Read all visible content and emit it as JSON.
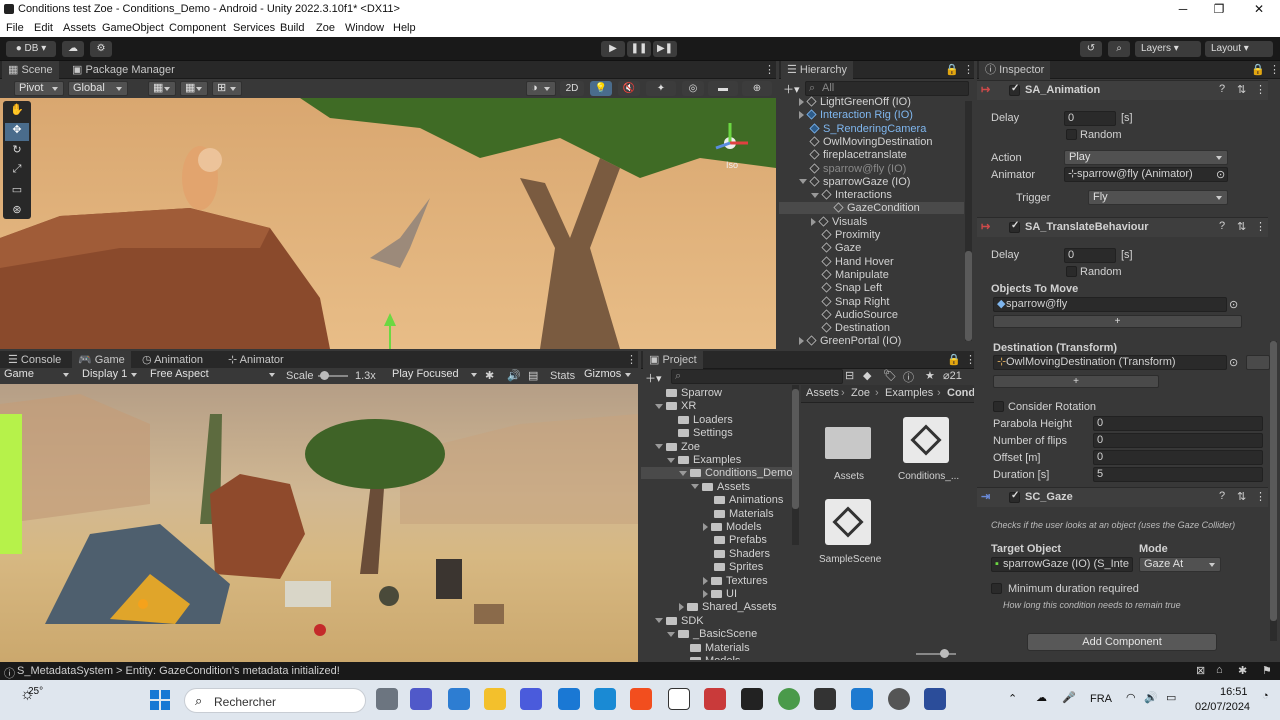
{
  "window": {
    "title": "Conditions test Zoe - Conditions_Demo - Android - Unity 2022.3.10f1* <DX11>",
    "minimize": "─",
    "maximize": "❐",
    "close": "✕"
  },
  "menu": [
    "File",
    "Edit",
    "Assets",
    "GameObject",
    "Component",
    "Services",
    "Build",
    "Zoe",
    "Window",
    "Help"
  ],
  "toolbar": {
    "account": "DB",
    "layers": "Layers",
    "layout": "Layout"
  },
  "scene_panel": {
    "tabs": [
      "Scene",
      "Package Manager"
    ],
    "pivot": "Pivot",
    "global": "Global",
    "mode_2d": "2D",
    "overlay_label": "Iso"
  },
  "hierarchy": {
    "tab": "Hierarchy",
    "search_placeholder": "All",
    "items": [
      {
        "label": "LightGreenOff (IO)",
        "style": "normal",
        "indent": 1,
        "arrow": "right"
      },
      {
        "label": "Interaction Rig (IO)",
        "style": "blue",
        "indent": 1,
        "arrow": "right"
      },
      {
        "label": "S_RenderingCamera",
        "style": "blue",
        "indent": 1,
        "arrow": "none"
      },
      {
        "label": "OwlMovingDestination",
        "style": "normal",
        "indent": 1,
        "arrow": "none"
      },
      {
        "label": "fireplacetranslate",
        "style": "normal",
        "indent": 1,
        "arrow": "none"
      },
      {
        "label": "sparrow@fly (IO)",
        "style": "gray",
        "indent": 1,
        "arrow": "none"
      },
      {
        "label": "sparrowGaze (IO)",
        "style": "normal",
        "indent": 1,
        "arrow": "down"
      },
      {
        "label": "Interactions",
        "style": "normal",
        "indent": 2,
        "arrow": "down"
      },
      {
        "label": "GazeCondition",
        "style": "selected",
        "indent": 3,
        "arrow": "none"
      },
      {
        "label": "Visuals",
        "style": "normal",
        "indent": 2,
        "arrow": "right"
      },
      {
        "label": "Proximity",
        "style": "normal",
        "indent": 2,
        "arrow": "none"
      },
      {
        "label": "Gaze",
        "style": "normal",
        "indent": 2,
        "arrow": "none"
      },
      {
        "label": "Hand Hover",
        "style": "normal",
        "indent": 2,
        "arrow": "none"
      },
      {
        "label": "Manipulate",
        "style": "normal",
        "indent": 2,
        "arrow": "none"
      },
      {
        "label": "Snap Left",
        "style": "normal",
        "indent": 2,
        "arrow": "none"
      },
      {
        "label": "Snap Right",
        "style": "normal",
        "indent": 2,
        "arrow": "none"
      },
      {
        "label": "AudioSource",
        "style": "normal",
        "indent": 2,
        "arrow": "none"
      },
      {
        "label": "Destination",
        "style": "normal",
        "indent": 2,
        "arrow": "none"
      },
      {
        "label": "GreenPortal (IO)",
        "style": "normal",
        "indent": 1,
        "arrow": "right"
      }
    ]
  },
  "game_panel": {
    "tabs": [
      "Console",
      "Game",
      "Animation",
      "Animator"
    ],
    "display_mode": "Game",
    "display": "Display 1",
    "aspect": "Free Aspect",
    "scale_label": "Scale",
    "scale_value": "1.3x",
    "play_focus": "Play Focused",
    "stats": "Stats",
    "gizmos": "Gizmos"
  },
  "project": {
    "tab": "Project",
    "count": "21",
    "tree": [
      {
        "label": "Sparrow",
        "indent": 1,
        "arrow": "none"
      },
      {
        "label": "XR",
        "indent": 1,
        "arrow": "down"
      },
      {
        "label": "Loaders",
        "indent": 2,
        "arrow": "none"
      },
      {
        "label": "Settings",
        "indent": 2,
        "arrow": "none"
      },
      {
        "label": "Zoe",
        "indent": 1,
        "arrow": "down"
      },
      {
        "label": "Examples",
        "indent": 2,
        "arrow": "down"
      },
      {
        "label": "Conditions_Demo",
        "indent": 3,
        "arrow": "down",
        "selected": true
      },
      {
        "label": "Assets",
        "indent": 4,
        "arrow": "down"
      },
      {
        "label": "Animations",
        "indent": 5,
        "arrow": "none"
      },
      {
        "label": "Materials",
        "indent": 5,
        "arrow": "none"
      },
      {
        "label": "Models",
        "indent": 5,
        "arrow": "right"
      },
      {
        "label": "Prefabs",
        "indent": 5,
        "arrow": "none"
      },
      {
        "label": "Shaders",
        "indent": 5,
        "arrow": "none"
      },
      {
        "label": "Sprites",
        "indent": 5,
        "arrow": "none"
      },
      {
        "label": "Textures",
        "indent": 5,
        "arrow": "right"
      },
      {
        "label": "UI",
        "indent": 5,
        "arrow": "right"
      },
      {
        "label": "Shared_Assets",
        "indent": 3,
        "arrow": "right"
      },
      {
        "label": "SDK",
        "indent": 1,
        "arrow": "down"
      },
      {
        "label": "_BasicScene",
        "indent": 2,
        "arrow": "down"
      },
      {
        "label": "Materials",
        "indent": 3,
        "arrow": "none"
      },
      {
        "label": "Models",
        "indent": 3,
        "arrow": "none"
      }
    ],
    "breadcrumb": [
      "Assets",
      "Zoe",
      "Examples",
      "Cond"
    ],
    "grid": [
      {
        "label": "Assets",
        "kind": "folder"
      },
      {
        "label": "Conditions_...",
        "kind": "unity"
      },
      {
        "label": "SampleScene",
        "kind": "unity"
      }
    ]
  },
  "inspector": {
    "tab": "Inspector",
    "sa_animation": {
      "title": "SA_Animation",
      "delay_label": "Delay",
      "delay_value": "0",
      "delay_unit": "[s]",
      "random_label": "Random",
      "action_label": "Action",
      "action_value": "Play",
      "animator_label": "Animator",
      "animator_value": "sparrow@fly (Animator)",
      "trigger_label": "Trigger",
      "trigger_value": "Fly"
    },
    "sa_translate": {
      "title": "SA_TranslateBehaviour",
      "delay_label": "Delay",
      "delay_value": "0",
      "delay_unit": "[s]",
      "random_label": "Random",
      "objects_label": "Objects To Move",
      "objects_value": "sparrow@fly",
      "add": "+",
      "dest_label": "Destination (Transform)",
      "dest_value": "OwlMovingDestination (Transform)",
      "consider_rotation": "Consider Rotation",
      "parabola_label": "Parabola Height",
      "parabola_value": "0",
      "flips_label": "Number of flips",
      "flips_value": "0",
      "offset_label": "Offset [m]",
      "offset_value": "0",
      "duration_label": "Duration [s]",
      "duration_value": "5"
    },
    "sc_gaze": {
      "title": "SC_Gaze",
      "desc": "Checks if the user looks at an object (uses the Gaze Collider)",
      "target_label": "Target Object",
      "target_value": "sparrowGaze (IO) (S_Inte",
      "mode_label": "Mode",
      "mode_value": "Gaze At",
      "min_duration": "Minimum duration required",
      "min_desc": "How long this condition needs to remain true"
    },
    "add_component": "Add Component"
  },
  "status": {
    "message": "S_MetadataSystem > Entity: GazeCondition's metadata initialized!"
  },
  "taskbar": {
    "weather": "25°",
    "search": "Rechercher",
    "lang": "FRA",
    "time": "16:51",
    "date": "02/07/2024"
  },
  "colors": {
    "editor_bg": "#383838",
    "selection": "#2c5d87",
    "accent_blue": "#7fb6ee"
  }
}
